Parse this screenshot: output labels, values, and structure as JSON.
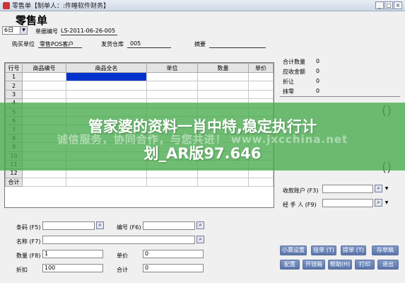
{
  "window": {
    "title": "零售单【制单人：:件睡软件财务】",
    "controls": [
      "_",
      "□",
      "×"
    ]
  },
  "form": {
    "title": "零售单",
    "period_value": "6日",
    "bill_no_label": "单据编号",
    "bill_no_value": "LS-2011-06-26-005",
    "buyer_label": "购买单位",
    "buyer_value": "零售POS客户",
    "warehouse_label": "发货仓库",
    "warehouse_value": "005",
    "summary_label": "摘要"
  },
  "grid": {
    "headers": [
      "行号",
      "商品编号",
      "商品全名",
      "单位",
      "数量",
      "单价"
    ],
    "rows": [
      "1",
      "2",
      "3",
      "4",
      "5",
      "6",
      "7",
      "8",
      "9",
      "10",
      "11",
      "12"
    ],
    "total_label": "合计"
  },
  "summary": {
    "items": [
      {
        "label": "合计数量",
        "value": "0"
      },
      {
        "label": "应收金额",
        "value": "0"
      },
      {
        "label": "折让",
        "value": "0"
      },
      {
        "label": "抹零",
        "value": "0"
      }
    ],
    "paren1": "()",
    "paren2": "()",
    "account_label": "收款账户 (F3)",
    "handler_label": "经 手 人 (F9)"
  },
  "bottom": {
    "barcode_label": "条码 (F5)",
    "code_label": "编号 (F6)",
    "name_label": "名称 (F7)",
    "qty_label": "数量 (F8)",
    "qty_value": "1",
    "price_label": "单价",
    "price_value": "0",
    "discount_label": "折扣",
    "discount_value": "100",
    "total_label": "合计",
    "total_value": "0"
  },
  "buttons": {
    "row1": [
      "小票设置",
      "挂单 (T)",
      "提单 (T)",
      "存草稿"
    ],
    "row2": [
      "配置",
      "开钱箱",
      "帮助(H)",
      "打印",
      "退出"
    ]
  },
  "overlay": {
    "line1": "管家婆的资料一肖中特,稳定执行计",
    "line2": "划_AR版97.646",
    "watermark": "诚信服务，协同合作，与您共进！ www.jxcchina.net"
  },
  "colors": {
    "selection": "#0033cc",
    "banner": "#46aa4b",
    "button": "#5a74aa"
  }
}
